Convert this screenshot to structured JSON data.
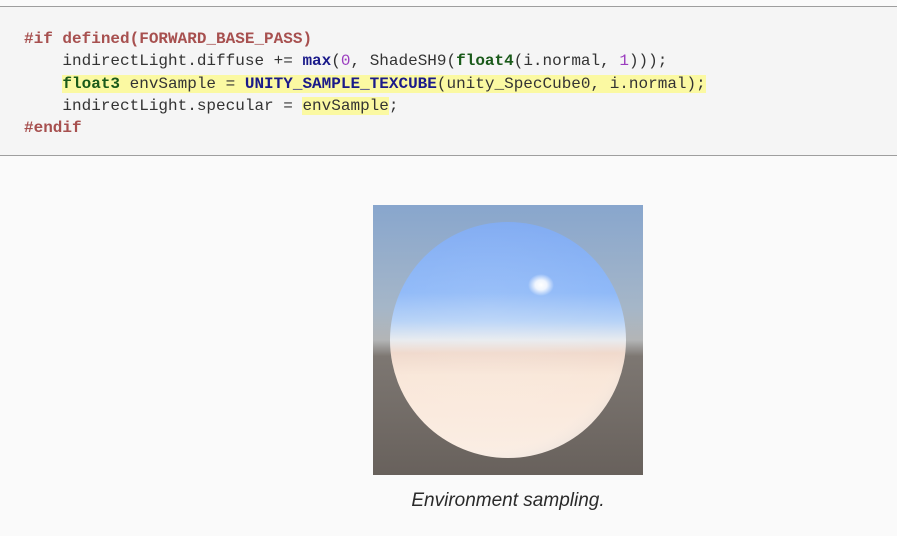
{
  "code": {
    "line1": {
      "pp": "#if defined(FORWARD_BASE_PASS)"
    },
    "line2": {
      "lhs": "indirectLight.diffuse += ",
      "fn_max": "max",
      "p1": "(",
      "zero": "0",
      "p2": ", ShadeSH9(",
      "type_float4": "float4",
      "p3": "(i.normal, ",
      "one": "1",
      "p4": ")));"
    },
    "line3": {
      "type_float3": "float3",
      "decl": " envSample = ",
      "macro": "UNITY_SAMPLE_TEXCUBE",
      "args": "(unity_SpecCube0, i.normal);"
    },
    "line4": {
      "lhs": "indirectLight.specular = ",
      "rhs": "envSample",
      "semi": ";"
    },
    "line5": {
      "pp": "#endif"
    }
  },
  "figure": {
    "sky_color": "#8eaacf",
    "ground_color": "#6b645f",
    "sphere_sky_color": "#90b8f6",
    "sphere_ground_color": "#f8e4d6",
    "highlight_icon": "sun-reflection-icon"
  },
  "caption": "Environment sampling."
}
